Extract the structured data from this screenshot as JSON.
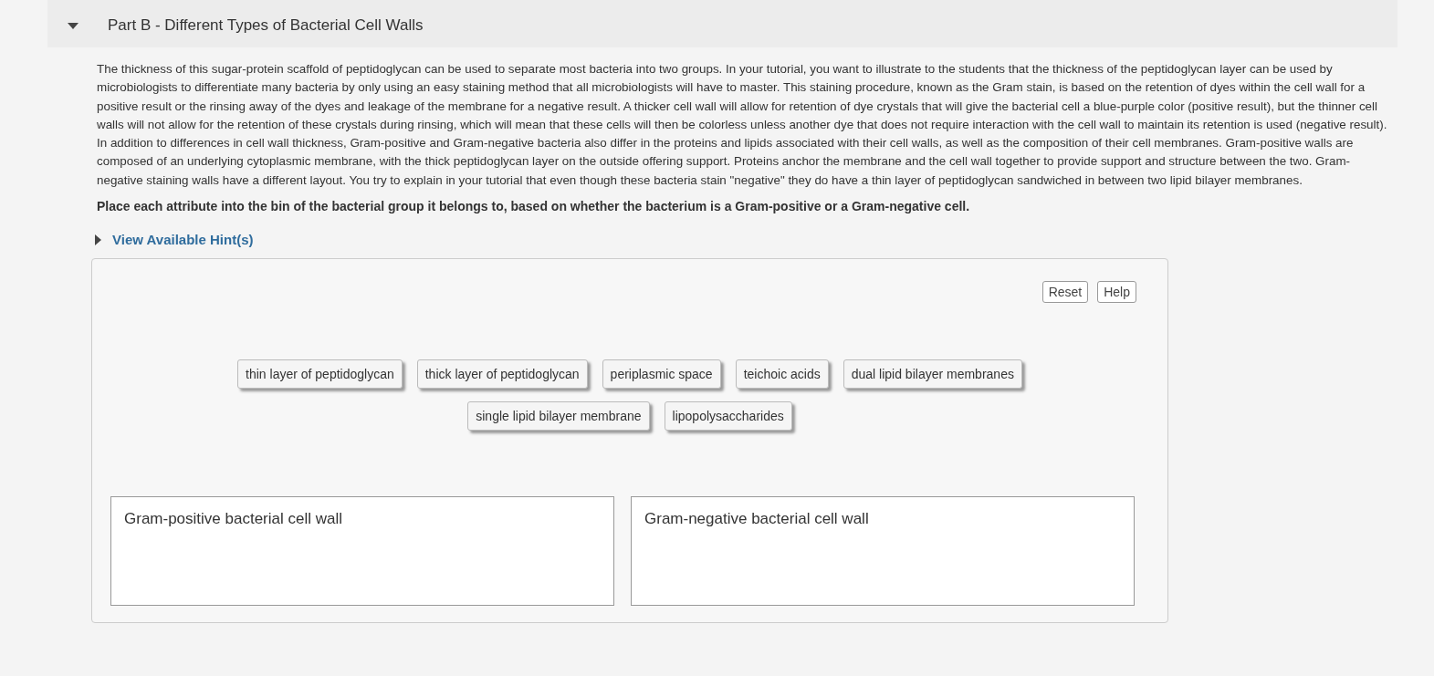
{
  "part": {
    "title": "Part B - Different Types of Bacterial Cell Walls",
    "expanded": true
  },
  "intro": "The thickness of this sugar-protein scaffold of peptidoglycan can be used to separate most bacteria into two groups. In your tutorial, you want to illustrate to the students that the thickness of the peptidoglycan layer can be used by microbiologists to differentiate many bacteria by only using an easy staining method that all microbiologists will have to master. This staining procedure, known as the Gram stain, is based on the retention of dyes within the cell wall for a positive result or the rinsing away of the dyes and leakage of the membrane for a negative result.  A thicker cell wall will allow for retention of dye crystals that will give the bacterial cell a blue-purple color (positive result), but the thinner cell walls will not allow for the retention of these crystals during rinsing, which will mean that these cells will then be colorless unless another dye that does not require interaction with the cell wall to maintain its retention is used (negative result). In addition to differences in cell wall thickness, Gram-positive and Gram-negative bacteria also differ in the proteins and lipids associated with their cell walls, as well as the composition of their cell membranes.  Gram-positive walls are composed of an underlying cytoplasmic membrane, with the thick peptidoglycan layer on the outside offering support.  Proteins anchor the membrane and the cell wall together to provide support and structure between the two. Gram-negative staining walls have a different layout. You try to explain in your tutorial that even though these bacteria stain \"negative\" they do have a thin layer of peptidoglycan sandwiched in between two lipid bilayer membranes.",
  "instruction": "Place each attribute into the bin of the bacterial group it belongs to, based on whether the bacterium is a Gram-positive or a Gram-negative cell.",
  "hints": {
    "label": "View Available Hint(s)",
    "expanded": false
  },
  "buttons": [
    "Reset",
    "Help"
  ],
  "labels": [
    "thin layer of peptidoglycan",
    "thick layer of peptidoglycan",
    "periplasmic space",
    "teichoic acids",
    "dual lipid bilayer membranes",
    "single lipid bilayer membrane",
    "lipopolysaccharides"
  ],
  "bins": [
    "Gram-positive bacterial cell wall",
    "Gram-negative bacterial cell wall"
  ]
}
